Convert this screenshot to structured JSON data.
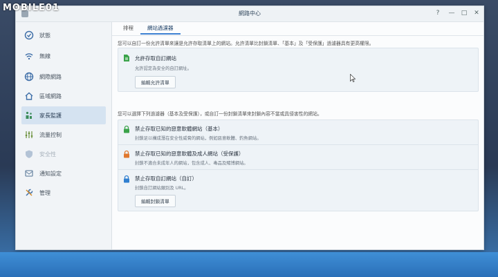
{
  "watermark": "MOBILE01",
  "window": {
    "title": "網路中心",
    "controls": {
      "help": "?",
      "minimize": "—",
      "maximize": "□",
      "close": "✕"
    }
  },
  "sidebar": {
    "items": [
      {
        "label": "狀態",
        "icon": "status-icon"
      },
      {
        "label": "無線",
        "icon": "wifi-icon"
      },
      {
        "label": "網際網路",
        "icon": "globe-icon"
      },
      {
        "label": "區域網路",
        "icon": "home-icon"
      },
      {
        "label": "家長監護",
        "icon": "family-icon",
        "active": true
      },
      {
        "label": "流量控制",
        "icon": "sliders-icon"
      },
      {
        "label": "安全性",
        "icon": "shield-icon"
      },
      {
        "label": "通知設定",
        "icon": "notification-icon"
      },
      {
        "label": "管理",
        "icon": "tools-icon"
      }
    ]
  },
  "tabs": [
    {
      "label": "排程"
    },
    {
      "label": "網站過濾器",
      "active": true
    }
  ],
  "allow_section": {
    "description": "您可以自訂一份允許清單來讓是允許存取清單上的網站。允許清單比封鎖清單、「基本」及「受保護」過濾器具有更高權限。",
    "title": "允許存取自訂網站",
    "subtitle": "允許認定為安全的自訂網址。",
    "button": "編輯允許清單"
  },
  "block_section": {
    "description": "您可以選擇下列過濾器（基本及受保護），或自訂一份封鎖清單來封鎖內容不當或具侵害性的網站。",
    "entries": [
      {
        "title": "禁止存取已知的惡意軟體網站（基本）",
        "subtitle": "封鎖足以構成潛在安全性威脅的網站，例如惡意軟體、釣魚網站。",
        "lock_color": "#3aa34a"
      },
      {
        "title": "禁止存取已知的惡意軟體及成人網站（受保護）",
        "subtitle": "封鎖不適合未成年人的網站，包含成人、毒品及賭博網站。",
        "lock_color": "#e0782f"
      },
      {
        "title": "禁止存取自訂網站（自訂）",
        "subtitle": "封鎖自訂網站類別及 URL。",
        "lock_color": "#2f7fd0"
      }
    ],
    "button": "編輯封鎖清單"
  }
}
